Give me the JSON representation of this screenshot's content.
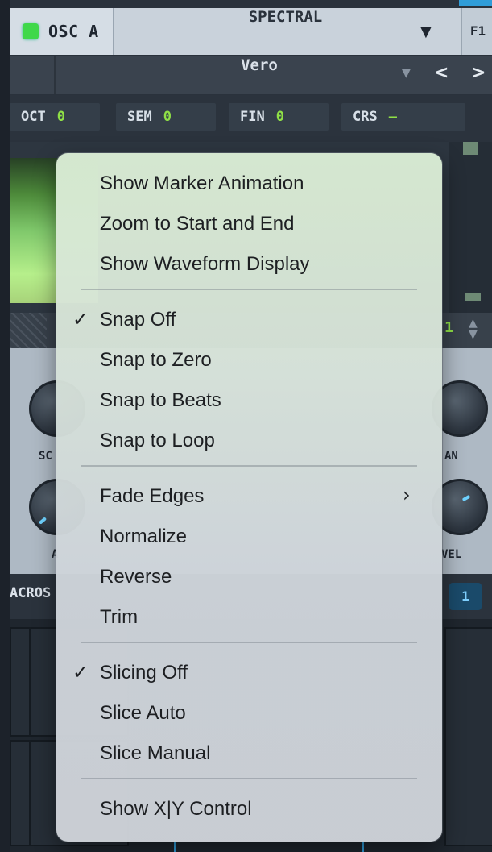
{
  "header": {
    "osc_label": "OSC A",
    "mode_label": "SPECTRAL",
    "mode_arrow": "▼",
    "filter_tab": "F1"
  },
  "wavetable": {
    "name": "Vero",
    "dropdown_arrow": "▼",
    "prev": "<",
    "next": ">"
  },
  "params": [
    {
      "label": "OCT",
      "value": "0"
    },
    {
      "label": "SEM",
      "value": "0"
    },
    {
      "label": "FIN",
      "value": "0"
    },
    {
      "label": "CRS",
      "value": "–"
    }
  ],
  "strip": {
    "value": "1"
  },
  "knob_labels": {
    "left_top": "SC",
    "right_top": "AN",
    "left_bottom": "A",
    "right_bottom": "VEL"
  },
  "macro": {
    "label": "ACROS",
    "badge": "1"
  },
  "menu": {
    "groups": [
      [
        {
          "label": "Show Marker Animation",
          "checked": false
        },
        {
          "label": "Zoom to Start and End",
          "checked": false
        },
        {
          "label": "Show Waveform Display",
          "checked": false
        }
      ],
      [
        {
          "label": "Snap Off",
          "checked": true
        },
        {
          "label": "Snap to Zero",
          "checked": false
        },
        {
          "label": "Snap to Beats",
          "checked": false
        },
        {
          "label": "Snap to Loop",
          "checked": false
        }
      ],
      [
        {
          "label": "Fade Edges",
          "checked": false,
          "submenu": true
        },
        {
          "label": "Normalize",
          "checked": false
        },
        {
          "label": "Reverse",
          "checked": false
        },
        {
          "label": "Trim",
          "checked": false
        }
      ],
      [
        {
          "label": "Slicing Off",
          "checked": true
        },
        {
          "label": "Slice Auto",
          "checked": false
        },
        {
          "label": "Slice Manual",
          "checked": false
        }
      ],
      [
        {
          "label": "Show X|Y Control",
          "checked": false
        }
      ]
    ],
    "check_glyph": "✓",
    "submenu_glyph": "›"
  }
}
